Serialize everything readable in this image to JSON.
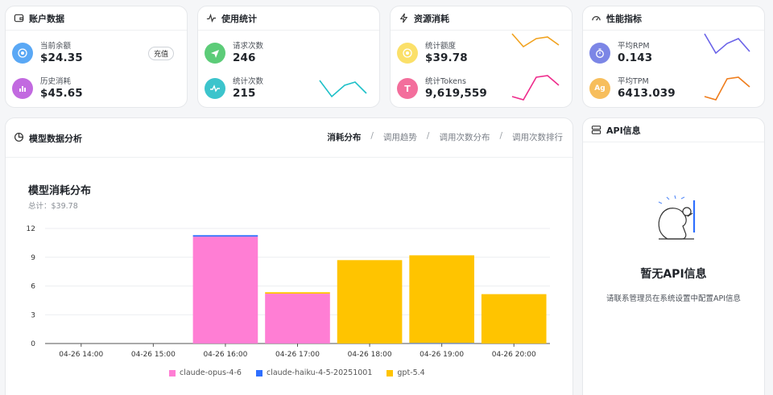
{
  "accent_colors": {
    "opus": "#ff7ed4",
    "haiku": "#2e6fff",
    "gpt": "#ffc400"
  },
  "account": {
    "title": "账户数据",
    "balance_label": "当前余额",
    "balance_value": "$24.35",
    "recharge_label": "充值",
    "history_label": "历史消耗",
    "history_value": "$45.65"
  },
  "usage": {
    "title": "使用统计",
    "requests_label": "请求次数",
    "requests_value": "246",
    "count_label": "统计次数",
    "count_value": "215"
  },
  "resource": {
    "title": "资源消耗",
    "quota_label": "统计额度",
    "quota_value": "$39.78",
    "tokens_label": "统计Tokens",
    "tokens_value": "9,619,559"
  },
  "performance": {
    "title": "性能指标",
    "rpm_label": "平均RPM",
    "rpm_value": "0.143",
    "tpm_label": "平均TPM",
    "tpm_value": "6413.039"
  },
  "analysis": {
    "title": "模型数据分析",
    "tabs": [
      "消耗分布",
      "调用趋势",
      "调用次数分布",
      "调用次数排行"
    ],
    "active_tab": "消耗分布"
  },
  "api_info": {
    "title": "API信息",
    "empty_title": "暂无API信息",
    "empty_desc": "请联系管理员在系统设置中配置API信息"
  },
  "chart_data": {
    "type": "bar",
    "title": "模型消耗分布",
    "subtitle": "总计：$39.78",
    "stacked": true,
    "categories": [
      "04-26 14:00",
      "04-26 15:00",
      "04-26 16:00",
      "04-26 17:00",
      "04-26 18:00",
      "04-26 19:00",
      "04-26 20:00"
    ],
    "series": [
      {
        "name": "claude-opus-4-6",
        "color": "#ff7ed4",
        "values": [
          0,
          0,
          11.15,
          5.2,
          0,
          0,
          0
        ]
      },
      {
        "name": "claude-haiku-4-5-20251001",
        "color": "#2e6fff",
        "values": [
          0,
          0,
          0.15,
          0,
          0,
          0.05,
          0
        ]
      },
      {
        "name": "gpt-5.4",
        "color": "#ffc400",
        "values": [
          0,
          0,
          0,
          0.15,
          8.7,
          9.15,
          5.15
        ]
      }
    ],
    "yticks": [
      0,
      3,
      6,
      9,
      12
    ],
    "ylim": [
      0,
      12
    ],
    "xlabel": "",
    "ylabel": "",
    "grid": true,
    "legend_position": "bottom"
  }
}
